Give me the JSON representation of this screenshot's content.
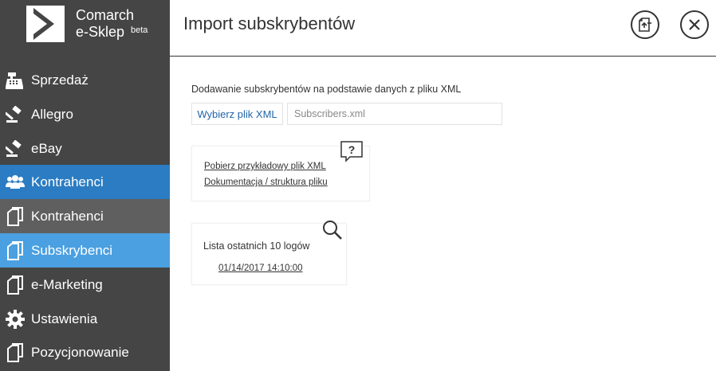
{
  "sidebar": {
    "logo": {
      "line1": "Comarch",
      "line2": "e-Sklep",
      "badge": "beta"
    },
    "items": [
      {
        "label": "Sprzedaż",
        "icon": "cash-register-icon"
      },
      {
        "label": "Allegro",
        "icon": "gavel-icon"
      },
      {
        "label": "eBay",
        "icon": "gavel-icon"
      },
      {
        "label": "Kontrahenci",
        "icon": "users-icon"
      },
      {
        "label": "Kontrahenci",
        "icon": "document-icon"
      },
      {
        "label": "Subskrybenci",
        "icon": "document-icon"
      },
      {
        "label": "e-Marketing",
        "icon": "document-icon"
      },
      {
        "label": "Ustawienia",
        "icon": "gear-icon"
      },
      {
        "label": "Pozycjonowanie",
        "icon": "document-icon"
      }
    ],
    "colors": {
      "background": "#454545",
      "active_section": "#2b7cc2",
      "submenu": "#5f5f5f",
      "selected": "#4aa0e0"
    }
  },
  "header": {
    "title": "Import subskrybentów",
    "export_icon": "export-document-icon",
    "close_icon": "close-icon"
  },
  "main": {
    "section_title": "Dodawanie subskrybentów na podstawie danych z pliku XML",
    "choose_button": "Wybierz plik XML",
    "file_value": "Subscribers.xml",
    "docs_card": {
      "help_icon": "question-mark-icon",
      "link_sample": "Pobierz przykładowy plik XML",
      "link_docs": "Dokumentacja / struktura pliku"
    },
    "logs_card": {
      "search_icon": "magnifier-icon",
      "title": "Lista ostatnich 10 logów",
      "entries": [
        "01/14/2017 14:10:00"
      ]
    }
  }
}
